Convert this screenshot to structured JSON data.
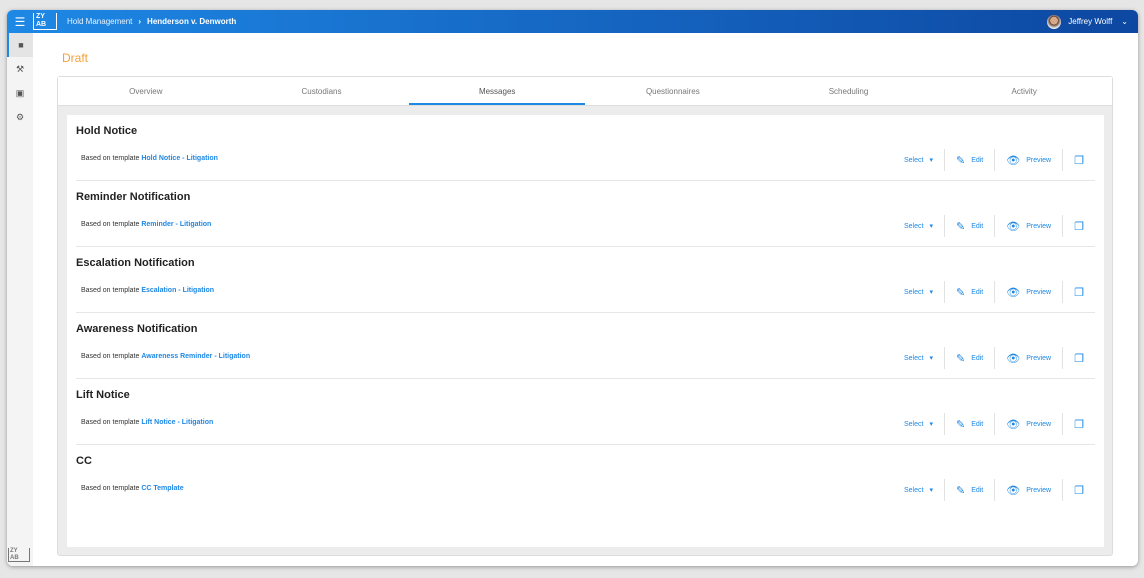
{
  "header": {
    "breadcrumb": [
      "Hold Management",
      "Henderson v. Denworth"
    ],
    "user": "Jeffrey Wolff",
    "logo": "ZY LAB"
  },
  "status": "Draft",
  "tabs": [
    "Overview",
    "Custodians",
    "Messages",
    "Questionnaires",
    "Scheduling",
    "Activity"
  ],
  "active_tab": "Messages",
  "template_prefix": "Based on template",
  "actions": {
    "select": "Select",
    "edit": "Edit",
    "preview": "Preview"
  },
  "messages": [
    {
      "title": "Hold Notice",
      "template": "Hold Notice - Litigation"
    },
    {
      "title": "Reminder Notification",
      "template": "Reminder - Litigation"
    },
    {
      "title": "Escalation Notification",
      "template": "Escalation - Litigation"
    },
    {
      "title": "Awareness Notification",
      "template": "Awareness Reminder - Litigation"
    },
    {
      "title": "Lift Notice",
      "template": "Lift Notice - Litigation"
    },
    {
      "title": "CC",
      "template": "CC Template"
    }
  ],
  "colors": {
    "accent": "#1e88e5",
    "draft": "#f5a13a"
  }
}
